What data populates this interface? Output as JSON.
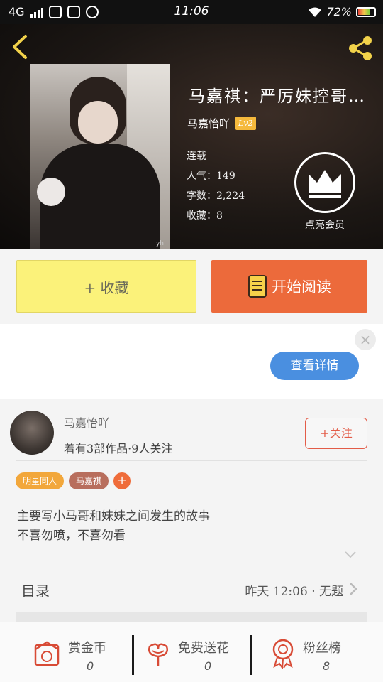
{
  "status_bar": {
    "network": "4G",
    "time": "11:06",
    "battery": "72%",
    "battery_level": 0.72
  },
  "book": {
    "title": "马嘉祺：严厉妹控哥…",
    "author": "马嘉怡吖",
    "level": "Lv2",
    "status": "连载",
    "popularity": "人气：149",
    "word_count": "字数：2,224",
    "favorites": "收藏：8",
    "cover_watermark": "yh"
  },
  "vip": {
    "label": "点亮会员",
    "icon": "crown-icon"
  },
  "actions": {
    "collect_label": "+ 收藏",
    "read_label": "开始阅读",
    "collect_color": "#fbf27a",
    "read_color": "#ec6a3b"
  },
  "ad": {
    "close": "×",
    "detail_label": "查看详情"
  },
  "author_card": {
    "name": "马嘉怡吖",
    "stats": "着有3部作品·9人关注",
    "follow_label": "+关注"
  },
  "tags": {
    "items": [
      "明星同人",
      "马嘉祺"
    ],
    "add": "+"
  },
  "synopsis": {
    "line1": "主要写小马哥和妹妹之间发生的故事",
    "line2": "不喜勿喷，不喜勿看"
  },
  "toc": {
    "label": "目录",
    "latest": "昨天 12:06 · 无题"
  },
  "bottom_bar": {
    "reward": {
      "label": "赏金币",
      "value": "0",
      "icon": "coin-envelope-icon"
    },
    "flower": {
      "label": "免费送花",
      "value": "0",
      "icon": "flower-icon"
    },
    "fans": {
      "label": "粉丝榜",
      "value": "8",
      "icon": "medal-icon"
    }
  },
  "colors": {
    "accent": "#ec6a3b",
    "tag_orange": "#f2a73b",
    "tag_brown": "#b86e5d",
    "blue": "#4a8fe0",
    "badge": "#f5b93c"
  }
}
